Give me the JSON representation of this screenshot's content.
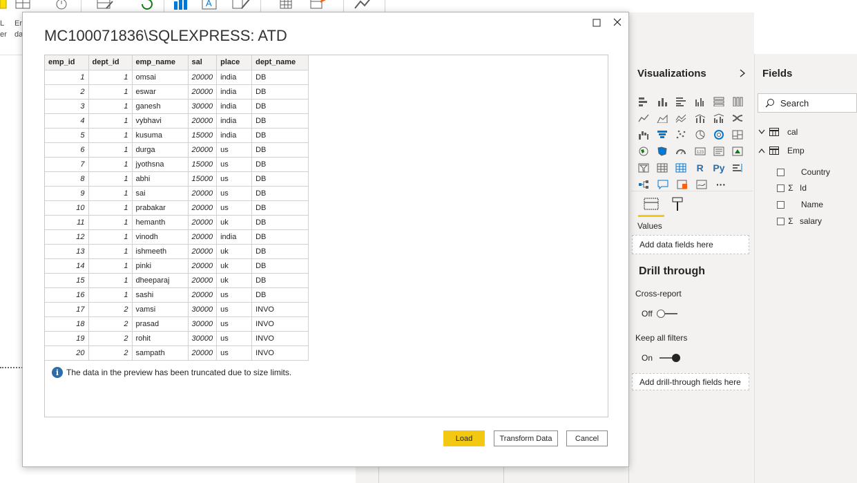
{
  "ribbon": {
    "frag_1": "L",
    "frag_2": "er",
    "frag_3": "En",
    "frag_4": "da"
  },
  "dialog": {
    "title": "MC100071836\\SQLEXPRESS: ATD",
    "columns": [
      "emp_id",
      "dept_id",
      "emp_name",
      "sal",
      "place",
      "dept_name"
    ],
    "rows": [
      [
        "1",
        "1",
        "omsai",
        "20000",
        "india",
        "DB"
      ],
      [
        "2",
        "1",
        "eswar",
        "20000",
        "india",
        "DB"
      ],
      [
        "3",
        "1",
        "ganesh",
        "30000",
        "india",
        "DB"
      ],
      [
        "4",
        "1",
        "vybhavi",
        "20000",
        "india",
        "DB"
      ],
      [
        "5",
        "1",
        "kusuma",
        "15000",
        "india",
        "DB"
      ],
      [
        "6",
        "1",
        "durga",
        "20000",
        "us",
        "DB"
      ],
      [
        "7",
        "1",
        "jyothsna",
        "15000",
        "us",
        "DB"
      ],
      [
        "8",
        "1",
        "abhi",
        "15000",
        "us",
        "DB"
      ],
      [
        "9",
        "1",
        "sai",
        "20000",
        "us",
        "DB"
      ],
      [
        "10",
        "1",
        "prabakar",
        "20000",
        "us",
        "DB"
      ],
      [
        "11",
        "1",
        "hemanth",
        "20000",
        "uk",
        "DB"
      ],
      [
        "12",
        "1",
        "vinodh",
        "20000",
        "india",
        "DB"
      ],
      [
        "13",
        "1",
        "ishmeeth",
        "20000",
        "uk",
        "DB"
      ],
      [
        "14",
        "1",
        "pinki",
        "20000",
        "uk",
        "DB"
      ],
      [
        "15",
        "1",
        "dheeparaj",
        "20000",
        "uk",
        "DB"
      ],
      [
        "16",
        "1",
        "sashi",
        "20000",
        "us",
        "DB"
      ],
      [
        "17",
        "2",
        "vamsi",
        "30000",
        "us",
        "INVO"
      ],
      [
        "18",
        "2",
        "prasad",
        "30000",
        "us",
        "INVO"
      ],
      [
        "19",
        "2",
        "rohit",
        "30000",
        "us",
        "INVO"
      ],
      [
        "20",
        "2",
        "sampath",
        "20000",
        "us",
        "INVO"
      ]
    ],
    "truncated_note": "The data in the preview has been truncated due to size limits.",
    "load_label": "Load",
    "transform_label": "Transform Data",
    "cancel_label": "Cancel"
  },
  "visualizations": {
    "title": "Visualizations",
    "r_label": "R",
    "py_label": "Py",
    "more_label": "···",
    "values_label": "Values",
    "values_well": "Add data fields here",
    "drill_title": "Drill through",
    "cross_report_label": "Cross-report",
    "cross_report_state": "Off",
    "keep_filters_label": "Keep all filters",
    "keep_filters_state": "On",
    "drill_well": "Add drill-through fields here"
  },
  "fields": {
    "title": "Fields",
    "search_placeholder": "Search",
    "tables": [
      {
        "name": "cal",
        "expanded": false
      },
      {
        "name": "Emp",
        "expanded": true
      }
    ],
    "emp_fields": [
      {
        "name": "Country",
        "sigma": false
      },
      {
        "name": "Id",
        "sigma": true
      },
      {
        "name": "Name",
        "sigma": false
      },
      {
        "name": "salary",
        "sigma": true
      }
    ]
  },
  "colors": {
    "accent_yellow": "#f2c811",
    "info_blue": "#2c6da8",
    "pane_bg": "#f3f2f1"
  },
  "icons": {
    "viz_row_1": [
      "stacked-bar-chart-icon",
      "stacked-column-chart-icon",
      "clustered-bar-chart-icon",
      "clustered-column-chart-icon",
      "100-stacked-bar-chart-icon",
      "100-stacked-column-chart-icon"
    ],
    "viz_row_2": [
      "line-chart-icon",
      "area-chart-icon",
      "stacked-area-chart-icon",
      "line-and-column-chart-icon",
      "line-and-clustered-column-chart-icon",
      "ribbon-chart-icon"
    ],
    "viz_row_3": [
      "waterfall-chart-icon",
      "funnel-chart-icon",
      "scatter-chart-icon",
      "pie-chart-icon",
      "donut-chart-icon",
      "treemap-icon"
    ],
    "viz_row_4": [
      "map-icon",
      "filled-map-icon",
      "gauge-icon",
      "card-icon",
      "multi-row-card-icon",
      "kpi-icon"
    ],
    "viz_row_5": [
      "slicer-icon",
      "table-icon",
      "matrix-icon",
      "r-visual-icon",
      "python-visual-icon",
      "key-influencers-icon"
    ],
    "viz_row_6": [
      "decomposition-tree-icon",
      "qa-icon",
      "smart-narrative-icon",
      "paginated-report-icon",
      "more-visuals-icon"
    ]
  }
}
